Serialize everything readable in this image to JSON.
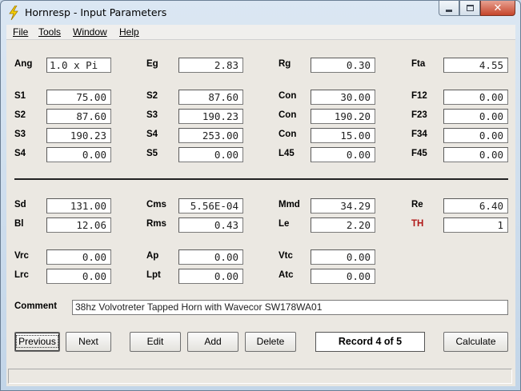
{
  "window": {
    "title": "Hornresp - Input Parameters"
  },
  "menu": [
    "File",
    "Tools",
    "Window",
    "Help"
  ],
  "rows": {
    "top": [
      {
        "l": "Ang",
        "v": "1.0 x Pi"
      },
      {
        "l": "Eg",
        "v": "2.83"
      },
      {
        "l": "Rg",
        "v": "0.30"
      },
      {
        "l": "Fta",
        "v": "4.55"
      }
    ],
    "r1": [
      {
        "l": "S1",
        "v": "75.00"
      },
      {
        "l": "S2",
        "v": "87.60"
      },
      {
        "l": "Con",
        "v": "30.00"
      },
      {
        "l": "F12",
        "v": "0.00"
      }
    ],
    "r2": [
      {
        "l": "S2",
        "v": "87.60"
      },
      {
        "l": "S3",
        "v": "190.23"
      },
      {
        "l": "Con",
        "v": "190.20"
      },
      {
        "l": "F23",
        "v": "0.00"
      }
    ],
    "r3": [
      {
        "l": "S3",
        "v": "190.23"
      },
      {
        "l": "S4",
        "v": "253.00"
      },
      {
        "l": "Con",
        "v": "15.00"
      },
      {
        "l": "F34",
        "v": "0.00"
      }
    ],
    "r4": [
      {
        "l": "S4",
        "v": "0.00"
      },
      {
        "l": "S5",
        "v": "0.00"
      },
      {
        "l": "L45",
        "v": "0.00"
      },
      {
        "l": "F45",
        "v": "0.00"
      }
    ],
    "d1": [
      {
        "l": "Sd",
        "v": "131.00"
      },
      {
        "l": "Cms",
        "v": "5.56E-04"
      },
      {
        "l": "Mmd",
        "v": "34.29"
      },
      {
        "l": "Re",
        "v": "6.40"
      }
    ],
    "d2": [
      {
        "l": "Bl",
        "v": "12.06"
      },
      {
        "l": "Rms",
        "v": "0.43"
      },
      {
        "l": "Le",
        "v": "2.20"
      },
      {
        "l": "TH",
        "v": "1"
      }
    ],
    "c1": [
      {
        "l": "Vrc",
        "v": "0.00"
      },
      {
        "l": "Ap",
        "v": "0.00"
      },
      {
        "l": "Vtc",
        "v": "0.00"
      }
    ],
    "c2": [
      {
        "l": "Lrc",
        "v": "0.00"
      },
      {
        "l": "Lpt",
        "v": "0.00"
      },
      {
        "l": "Atc",
        "v": "0.00"
      }
    ]
  },
  "comment": {
    "label": "Comment",
    "value": "38hz Volvotreter Tapped Horn with Wavecor SW178WA01"
  },
  "buttons": {
    "previous": "Previous",
    "next": "Next",
    "edit": "Edit",
    "add": "Add",
    "delete": "Delete",
    "calculate": "Calculate"
  },
  "record": "Record 4 of 5",
  "colors": {
    "th_label": "#b01818"
  }
}
